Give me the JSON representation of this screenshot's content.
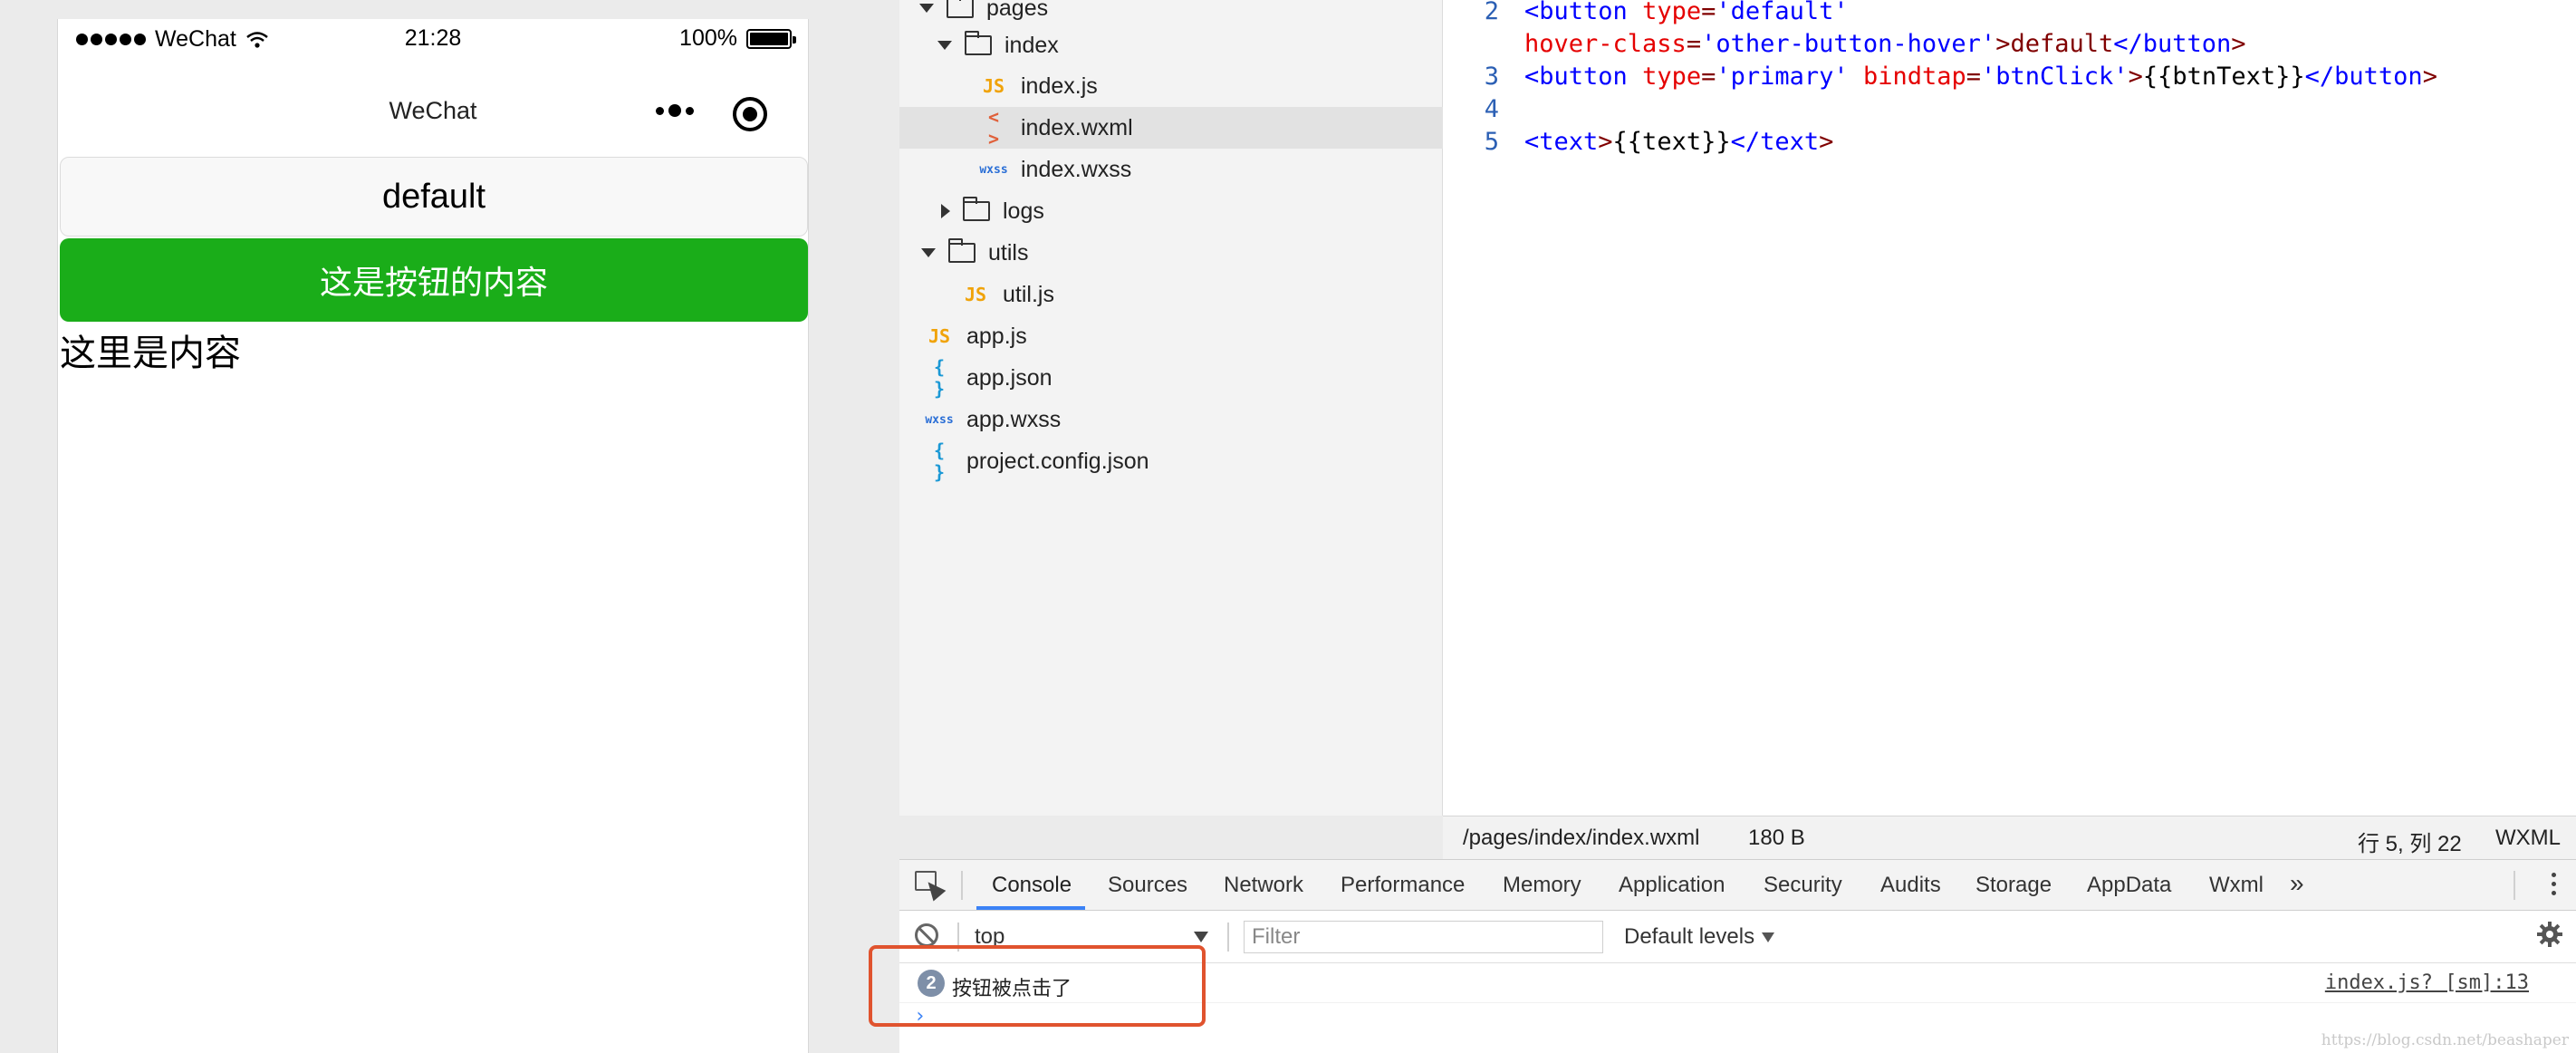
{
  "simulator": {
    "status": {
      "carrier": "WeChat",
      "time": "21:28",
      "battery": "100%"
    },
    "nav_title": "WeChat",
    "default_button": "default",
    "primary_button": "这是按钮的内容",
    "content_text": "这里是内容"
  },
  "filetree": {
    "items": [
      {
        "label": "pages",
        "type": "folder",
        "expanded": true
      },
      {
        "label": "index",
        "type": "folder",
        "expanded": true
      },
      {
        "label": "index.js",
        "icon": "JS"
      },
      {
        "label": "index.wxml",
        "icon": "< >",
        "selected": true
      },
      {
        "label": "index.wxss",
        "icon": "wxss"
      },
      {
        "label": "logs",
        "type": "folder",
        "expanded": false
      },
      {
        "label": "utils",
        "type": "folder",
        "expanded": true
      },
      {
        "label": "util.js",
        "icon": "JS"
      },
      {
        "label": "app.js",
        "icon": "JS"
      },
      {
        "label": "app.json",
        "icon": "{ }"
      },
      {
        "label": "app.wxss",
        "icon": "wxss"
      },
      {
        "label": "project.config.json",
        "icon": "{ }"
      }
    ]
  },
  "editor": {
    "lines": [
      {
        "num": "2",
        "text": "<button type='default'"
      },
      {
        "num": "",
        "text": "hover-class='other-button-hover'>default</button>"
      },
      {
        "num": "3",
        "text": "<button type='primary' bindtap='btnClick'>{{btnText}}</button>"
      },
      {
        "num": "4",
        "text": ""
      },
      {
        "num": "5",
        "text": "<text>{{text}}</text>"
      }
    ]
  },
  "editor_status": {
    "path": "/pages/index/index.wxml",
    "size": "180 B",
    "cursor": "行 5, 列 22",
    "lang": "WXML"
  },
  "devtools": {
    "tabs": [
      "Console",
      "Sources",
      "Network",
      "Performance",
      "Memory",
      "Application",
      "Security",
      "Audits",
      "Storage",
      "AppData",
      "Wxml"
    ],
    "overflow": "»",
    "active_tab": "Console",
    "context": "top",
    "filter_placeholder": "Filter",
    "levels": "Default levels",
    "log": {
      "count": "2",
      "message": "按钮被点击了",
      "source": "index.js? [sm]:13"
    },
    "prompt": "›"
  },
  "watermark": "https://blog.csdn.net/beashaper",
  "colors": {
    "primary_button": "#1aad19",
    "highlight": "#e0532e",
    "tab_active": "#3b82f6"
  }
}
